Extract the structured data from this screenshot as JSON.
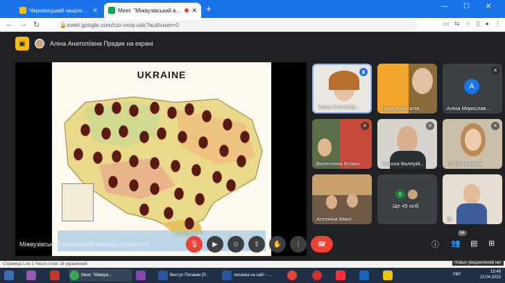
{
  "browser": {
    "tabs": [
      {
        "title": "Чернівецький національний ун",
        "active": false
      },
      {
        "title": "Meet: \"Міжвузівський вебіна",
        "active": true
      }
    ],
    "new_tab": "+",
    "url": "meet.google.com/czr-vxrq-udc?authuser=0",
    "window_controls": {
      "minimize": "—",
      "maximize": "☐",
      "close": "✕"
    }
  },
  "meet": {
    "presenter_label": "Аліна Анатоліївна Предик на екрані",
    "slide_title": "UKRAINE",
    "participants": [
      {
        "name": "Аліна Анатоліїв...",
        "speaking": true
      },
      {
        "name": "Лариса Василів..."
      },
      {
        "name": "Аліна Мирослав...",
        "initial": "A"
      },
      {
        "name": "Валентина Влаюк"
      },
      {
        "name": "Альона Валерій..."
      },
      {
        "name": "Софія Іванівна"
      },
      {
        "name": "Антоніна Мико..."
      },
      {
        "name": "Ще 45 осіб",
        "count": "0"
      },
      {
        "name": "Ви"
      }
    ],
    "meeting_title": "Міжвузівський великодній вебінар-практикум \"...",
    "people_count": "54"
  },
  "statusbar": {
    "text": "Страница 1 из 1    Число слов: 28    украинский",
    "notification": "Новых уведомлений нет"
  },
  "taskbar": {
    "items": [
      {
        "label": "Meet: \"Міжвузі...",
        "color": "#34a853"
      },
      {
        "label": "Виступ Писанки [Р...",
        "color": "#2b579a"
      },
      {
        "label": "писанка на сайт - ...",
        "color": "#2b579a"
      }
    ],
    "lang": "УКР",
    "time": "15:48",
    "date": "12.04.2023"
  },
  "colors": {
    "accent": "#1a73e8",
    "end_call": "#ea4335",
    "bg": "#202124"
  }
}
